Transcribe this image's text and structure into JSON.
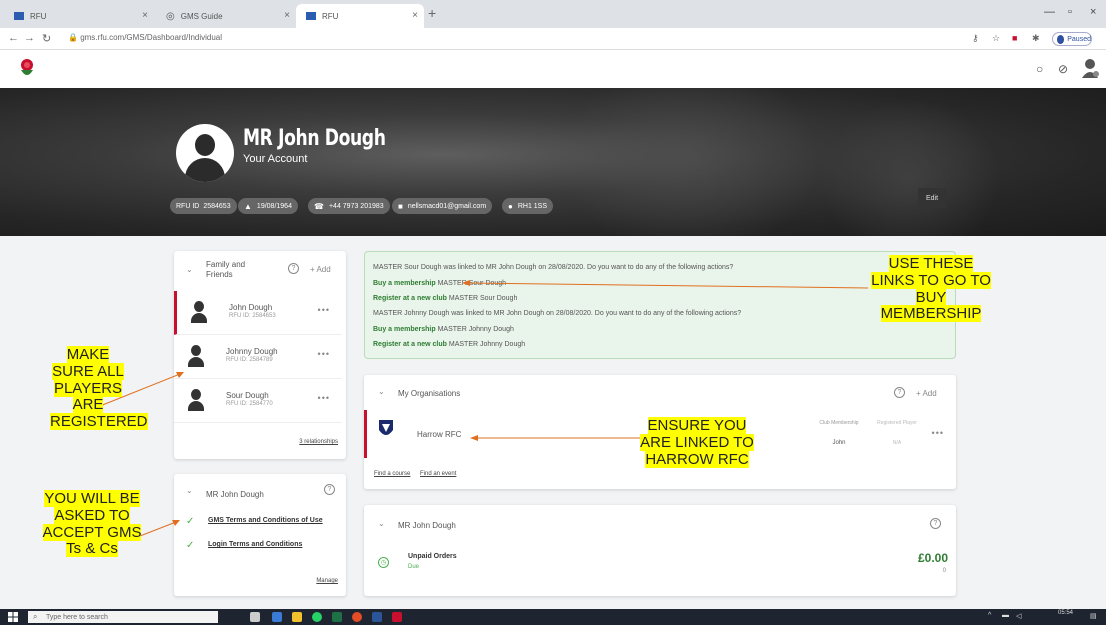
{
  "browser": {
    "tabs": [
      {
        "title": "RFU"
      },
      {
        "title": "GMS Guide"
      },
      {
        "title": "RFU"
      }
    ],
    "url": "gms.rfu.com/GMS/Dashboard/Individual",
    "profile_status": "Paused"
  },
  "hero": {
    "name": "MR John Dough",
    "subtitle": "Your Account",
    "rfu_id_label": "RFU ID",
    "rfu_id": "2584653",
    "dob": "19/08/1964",
    "phone": "+44 7973 201983",
    "email": "nellsmacd01@gmail.com",
    "postcode": "RH1 1SS",
    "edit_label": "Edit"
  },
  "family": {
    "title": "Family and Friends",
    "add_label": "+ Add",
    "members": [
      {
        "name": "John Dough",
        "id": "RFU ID: 2584653"
      },
      {
        "name": "Johnny Dough",
        "id": "RFU ID: 2584789"
      },
      {
        "name": "Sour Dough",
        "id": "RFU ID: 2584770"
      }
    ],
    "relationships_link": "3 relationships"
  },
  "terms": {
    "title": "MR John Dough",
    "items": [
      "GMS Terms and Conditions of Use",
      "Login Terms and Conditions"
    ],
    "manage_link": "Manage"
  },
  "notice": {
    "line1": "MASTER Sour Dough was linked to MR John Dough on 28/08/2020. Do you want to do any of the following actions?",
    "action1_bold": "Buy a membership",
    "action1_rest": "MASTER Sour Dough",
    "action2_bold": "Register at a new club",
    "action2_rest": "MASTER Sour Dough",
    "line2": "MASTER Johnny Dough was linked to MR John Dough on 28/08/2020. Do you want to do any of the following actions?",
    "action3_bold": "Buy a membership",
    "action3_rest": "MASTER Johnny Dough",
    "action4_bold": "Register at a new club",
    "action4_rest": "MASTER Johnny Dough"
  },
  "organisations": {
    "title": "My Organisations",
    "add_label": "+ Add",
    "club": "Harrow RFC",
    "membership_label": "Club Membership",
    "membership_value": "John",
    "player_label": "Registered Player",
    "player_value": "N/A",
    "find_course": "Find a course",
    "find_event": "Find an event"
  },
  "orders": {
    "title": "MR John Dough",
    "label": "Unpaid Orders",
    "status": "Due",
    "amount": "£0.00",
    "amount_note": "0"
  },
  "annotations": {
    "links": "USE THESE LINKS TO GO TO BUY MEMBERSHIP",
    "players": "MAKE SURE ALL PLAYERS ARE REGISTERED",
    "harrow": "ENSURE YOU ARE LINKED TO HARROW RFC",
    "terms": "YOU WILL BE ASKED TO ACCEPT GMS Ts & Cs"
  },
  "taskbar": {
    "search_placeholder": "Type here to search",
    "time": "05:54"
  },
  "colors": {
    "accent_red": "#c8102e",
    "green": "#2e7d32",
    "highlight": "#ffff00"
  }
}
